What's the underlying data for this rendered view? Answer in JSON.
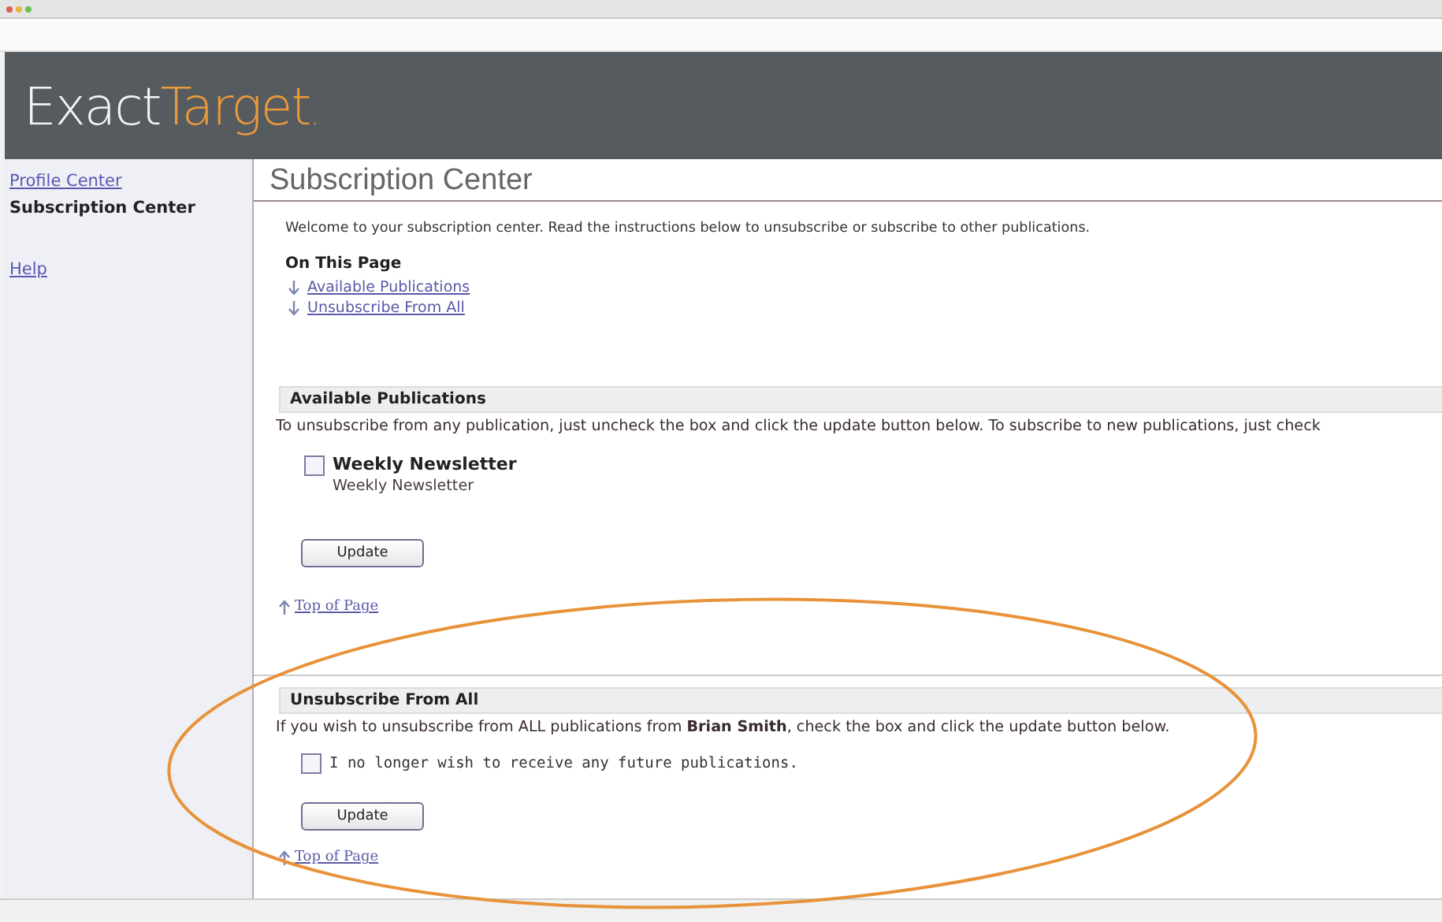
{
  "logo": {
    "first": "Exact",
    "second": "Target",
    "dot": "."
  },
  "sidebar": {
    "items": [
      {
        "label": "Profile Center",
        "selected": false
      },
      {
        "label": "Subscription Center",
        "selected": true
      },
      {
        "label": "Help",
        "selected": false
      }
    ]
  },
  "page_title": "Subscription Center",
  "welcome": "Welcome to your subscription center. Read the instructions below to unsubscribe or subscribe to other publications.",
  "on_this_page": {
    "heading": "On This Page",
    "links": [
      "Available Publications",
      "Unsubscribe From All"
    ]
  },
  "sections": [
    {
      "kind": "publications",
      "heading": "Available Publications",
      "text": "To unsubscribe from any publication, just uncheck the box and click the update button below. To subscribe to new publications, just check",
      "options": [
        {
          "label": "Weekly Newsletter",
          "description": "Weekly Newsletter",
          "checked": false
        }
      ],
      "button": "Update",
      "top_link": "Top of Page"
    },
    {
      "kind": "unsubscribe",
      "heading": "Unsubscribe From All",
      "text": "If you wish to unsubscribe from ALL publications from **Brian Smith**, check the box and click the update button below.",
      "options": [
        {
          "label": "I no longer wish to receive any future publications.",
          "checked": false
        }
      ],
      "button": "Update",
      "top_link": "Top of Page"
    }
  ],
  "annotation": {
    "kind": "ellipse"
  }
}
